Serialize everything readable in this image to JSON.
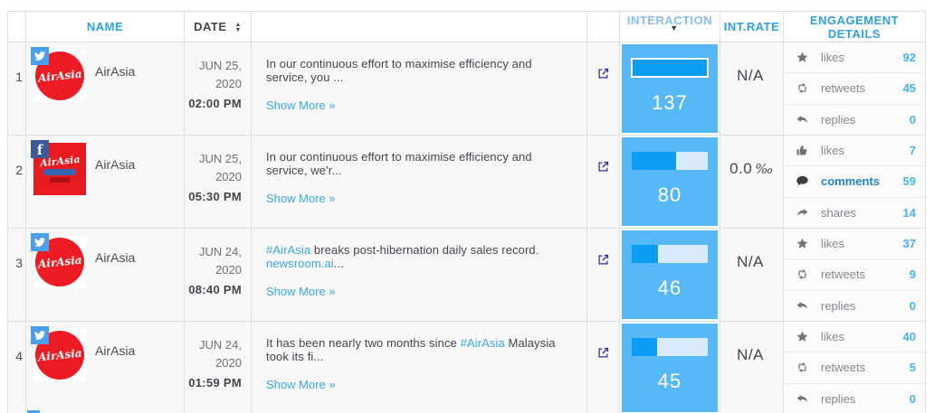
{
  "table": {
    "headers": {
      "name": "NAME",
      "date": "DATE",
      "interaction": "INTERACTION",
      "int_rate": "INT.RATE",
      "engagement": "ENGAGEMENT DETAILS"
    }
  },
  "icons": {
    "facebook": "f"
  },
  "colors": {
    "header_blue": "#2fa0df",
    "link_blue": "#38a8ea",
    "interaction_bg": "#57b8f8",
    "bar_fill": "#0c9cf2",
    "value_blue": "#47b1f5",
    "twitter_blue": "#4aa0ec",
    "facebook_blue": "#3b5998",
    "airasia_red": "#ec1b24"
  },
  "rows": [
    {
      "num": "1",
      "network": "twitter",
      "name": "AirAsia",
      "logo_text": "AirAsia",
      "date_line1": "JUN 25,",
      "date_line2": "2020",
      "time": "02:00 PM",
      "content": [
        {
          "t": "In our continuous effort to maximise efficiency and service, you ..."
        }
      ],
      "show_more": "Show More »",
      "interaction": {
        "value": "137",
        "pct": "100%"
      },
      "int_rate": {
        "num": "N/A",
        "unit": ""
      },
      "engagement": [
        {
          "label": "likes",
          "value": "92"
        },
        {
          "label": "retweets",
          "value": "45"
        },
        {
          "label": "replies",
          "value": "0"
        }
      ]
    },
    {
      "num": "2",
      "network": "facebook",
      "name": "AirAsia",
      "logo_text": "AirAsia",
      "date_line1": "JUN 25,",
      "date_line2": "2020",
      "time": "05:30 PM",
      "content": [
        {
          "t": "In our continuous effort to maximise efficiency and service, we'r..."
        }
      ],
      "show_more": "Show More »",
      "interaction": {
        "value": "80",
        "pct": "58%"
      },
      "int_rate": {
        "num": "0.0",
        "unit": "‰"
      },
      "engagement": [
        {
          "label": "likes",
          "value": "7"
        },
        {
          "label": "comments",
          "value": "59"
        },
        {
          "label": "shares",
          "value": "14"
        }
      ]
    },
    {
      "num": "3",
      "network": "twitter",
      "name": "AirAsia",
      "logo_text": "AirAsia",
      "date_line1": "JUN 24,",
      "date_line2": "2020",
      "time": "08:40 PM",
      "content": [
        {
          "t": "#AirAsia"
        },
        {
          "t": " breaks post-hibernation daily sales record. "
        },
        {
          "t": "newsroom.ai"
        },
        {
          "t": "..."
        }
      ],
      "show_more": "Show More »",
      "interaction": {
        "value": "46",
        "pct": "34%"
      },
      "int_rate": {
        "num": "N/A",
        "unit": ""
      },
      "engagement": [
        {
          "label": "likes",
          "value": "37"
        },
        {
          "label": "retweets",
          "value": "9"
        },
        {
          "label": "replies",
          "value": "0"
        }
      ]
    },
    {
      "num": "4",
      "network": "twitter",
      "name": "AirAsia",
      "logo_text": "AirAsia",
      "date_line1": "JUN 24,",
      "date_line2": "2020",
      "time": "01:59 PM",
      "content": [
        {
          "t": "It has been nearly two months since "
        },
        {
          "t": "#AirAsia"
        },
        {
          "t": " Malaysia took its fi..."
        }
      ],
      "show_more": "Show More »",
      "interaction": {
        "value": "45",
        "pct": "33%"
      },
      "int_rate": {
        "num": "N/A",
        "unit": ""
      },
      "engagement": [
        {
          "label": "likes",
          "value": "40"
        },
        {
          "label": "retweets",
          "value": "5"
        },
        {
          "label": "replies",
          "value": "0"
        }
      ]
    }
  ]
}
